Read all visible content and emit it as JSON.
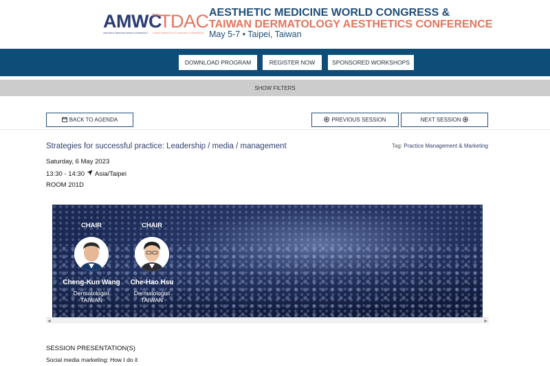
{
  "header": {
    "logo_left": "AMWC",
    "logo_asia": "Asia",
    "logo_right": "TDAC",
    "logo_sub_left": "AESTHETIC MEDICINE WORLD CONGRESS &",
    "logo_sub_right": "TAIWAN DERMATOLOGY AESTHETIC CONFERENCE",
    "line1": "AESTHETIC MEDICINE WORLD CONGRESS &",
    "line2": "TAIWAN DERMATOLOGY AESTHETICS CONFERENCE",
    "date_place": "May 5-7 • Taipei, Taiwan"
  },
  "nav": {
    "download_program": "DOWNLOAD PROGRAM",
    "register_now": "REGISTER NOW",
    "sponsored_workshops": "SPONSORED WORKSHOPS"
  },
  "filters": {
    "label": "SHOW FILTERS"
  },
  "session_nav": {
    "back": "BACK TO AGENDA",
    "previous": "PREVIOUS SESSION",
    "next": "NEXT SESSION"
  },
  "session": {
    "title": "Strategies for successful practice: Leadership / media / management",
    "tag_label": "Tag:",
    "tag_value": "Practice Management & Marketing",
    "date": "Saturday, 6 May 2023",
    "time": "13:30 - 14:30",
    "timezone": "Asia/Taipei",
    "room": "ROOM 201D"
  },
  "speakers": [
    {
      "role": "CHAIR",
      "name": "Cheng-Kun Wang",
      "title": "Dermatologist",
      "country": "TAIWAN"
    },
    {
      "role": "CHAIR",
      "name": "Che-Hao Hsu",
      "title": "Dermatologist",
      "country": "TAIWAN"
    }
  ],
  "presentations": {
    "heading": "SESSION PRESENTATION(S)",
    "items": [
      "Social media marketing: How I do it"
    ]
  },
  "colors": {
    "brand_navy": "#0e4d77",
    "brand_coral": "#e5735d",
    "filter_gray": "#cccccc"
  },
  "icons": [
    "calendar-icon",
    "circle-arrow-left-icon",
    "circle-arrow-right-icon",
    "location-arrow-icon"
  ]
}
